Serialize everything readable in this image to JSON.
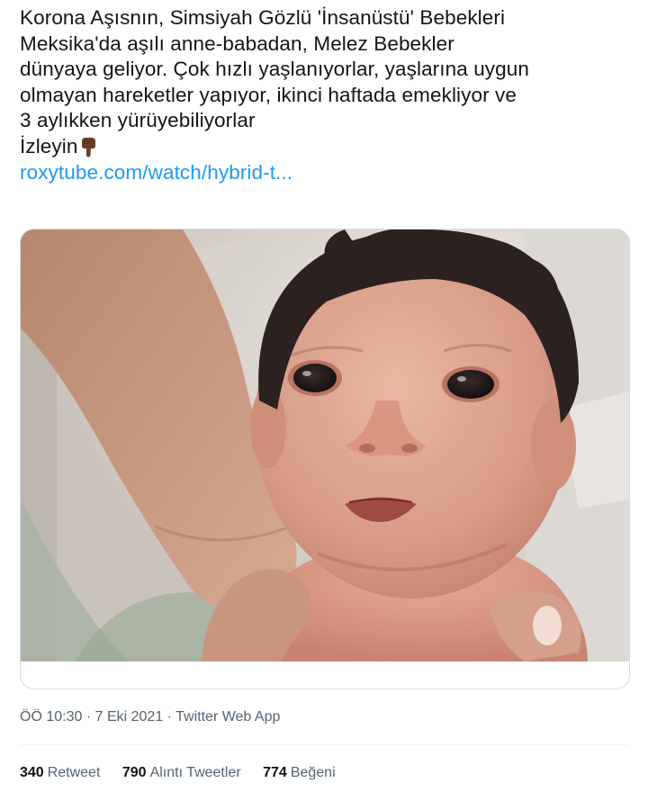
{
  "tweet": {
    "text_lines": [
      "Korona Aşısnın, Simsiyah Gözlü 'İnsanüstü' Bebekleri",
      "Meksika'da aşılı anne-babadan, Melez Bebekler",
      "dünyaya geliyor. Çok hızlı yaşlanıyorlar, yaşlarına uygun",
      "olmayan hareketler yapıyor, ikinci haftada emekliyor ve",
      "3 aylıkken yürüyebiliyorlar"
    ],
    "call_to_action": "İzleyin",
    "emoji": "pointing-down-hand-icon",
    "link_text": "roxytube.com/watch/hybrid-t...",
    "link_color": "#1d9bf0"
  },
  "media": {
    "icon": "baby-photo"
  },
  "meta": {
    "time": "ÖÖ 10:30",
    "separator": "·",
    "date": "7 Eki 2021",
    "source": "Twitter Web App"
  },
  "stats": [
    {
      "count": "340",
      "label": "Retweet"
    },
    {
      "count": "790",
      "label": "Alıntı Tweetler"
    },
    {
      "count": "774",
      "label": "Beğeni"
    }
  ],
  "colors": {
    "text": "#141414",
    "secondary": "#536471",
    "card_border": "#d6dbe0"
  }
}
